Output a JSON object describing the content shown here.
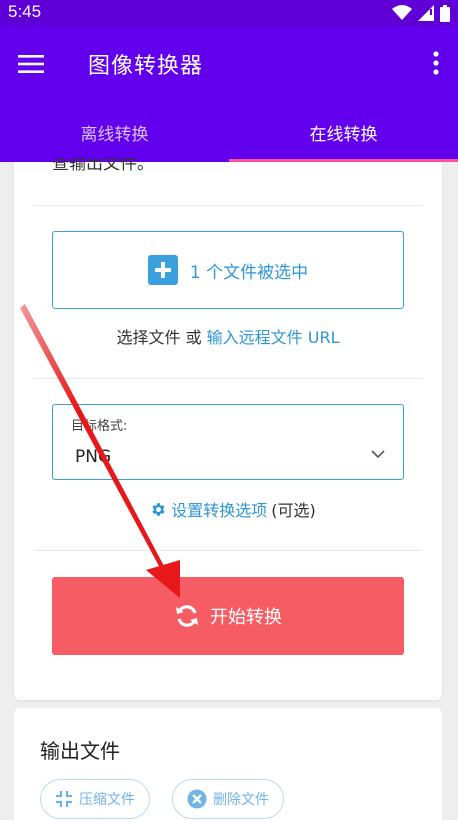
{
  "status_bar": {
    "time": "5:45"
  },
  "app_bar": {
    "title": "图像转换器"
  },
  "tabs": [
    {
      "label": "离线转换",
      "active": false
    },
    {
      "label": "在线转换",
      "active": true
    }
  ],
  "converter": {
    "truncated_text": "查输出文件。",
    "file_select": {
      "label": "1 个文件被选中"
    },
    "choose_line": {
      "prefix": "选择文件 或 ",
      "link": "输入远程文件 URL"
    },
    "format": {
      "label": "目标格式:",
      "value": "PNG"
    },
    "options": {
      "link": "设置转换选项",
      "suffix": "(可选)"
    },
    "start_button": {
      "label": "开始转换"
    }
  },
  "output": {
    "title": "输出文件",
    "compress_button": "压缩文件",
    "delete_button": "删除文件"
  },
  "colors": {
    "app_bar": "#6200ee",
    "accent_link": "#2f96d6",
    "start_button": "#f55c63",
    "tab_indicator": "#ff4f9a",
    "annotation_arrow": "#e8171a"
  }
}
